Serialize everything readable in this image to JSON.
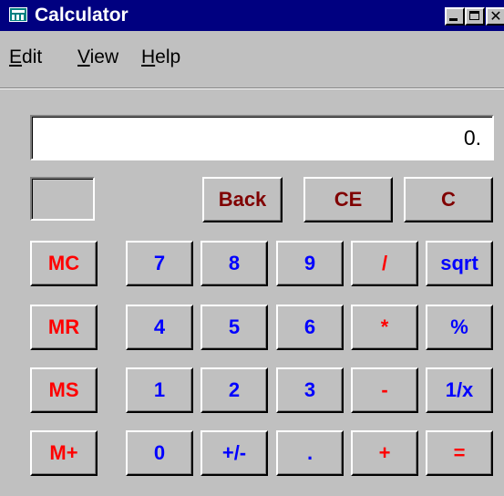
{
  "window": {
    "title": "Calculator"
  },
  "menu": {
    "edit": "Edit",
    "view": "View",
    "help": "Help"
  },
  "display": {
    "value": "0."
  },
  "buttons": {
    "back": "Back",
    "ce": "CE",
    "c": "C",
    "mc": "MC",
    "mr": "MR",
    "ms": "MS",
    "mplus": "M+",
    "n7": "7",
    "n8": "8",
    "n9": "9",
    "div": "/",
    "sqrt": "sqrt",
    "n4": "4",
    "n5": "5",
    "n6": "6",
    "mul": "*",
    "pct": "%",
    "n1": "1",
    "n2": "2",
    "n3": "3",
    "sub": "-",
    "recip": "1/x",
    "n0": "0",
    "sign": "+/-",
    "dot": ".",
    "add": "+",
    "eq": "="
  },
  "colors": {
    "titlebar": "#000080",
    "face": "#c0c0c0",
    "memory_ops": "#ff0000",
    "digits": "#0000ff",
    "edit_ops": "#800000"
  }
}
